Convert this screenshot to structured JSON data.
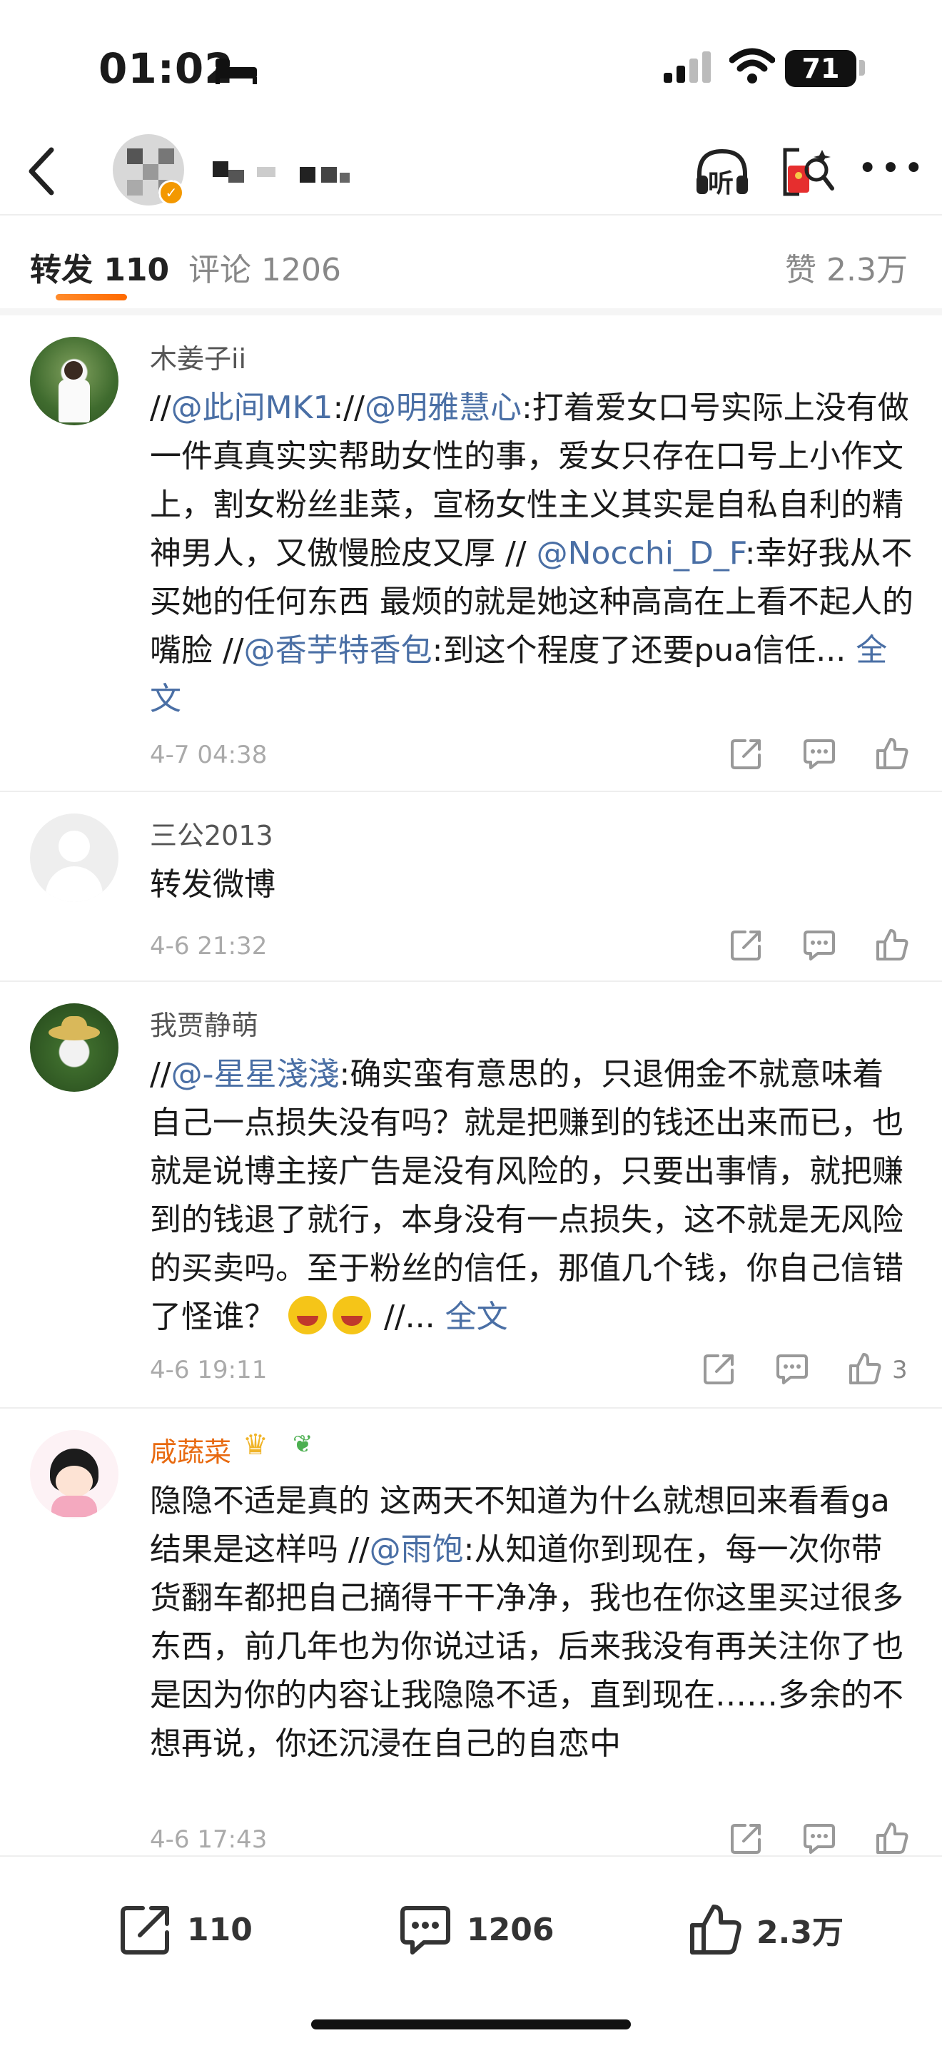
{
  "status_bar": {
    "time": "01:02",
    "battery": "71"
  },
  "nav": {
    "listen_label": "听"
  },
  "tabs": {
    "forward": "转发 110",
    "comment": "评论 1206",
    "like": "赞 2.3万"
  },
  "items": [
    {
      "username": "木姜子ii",
      "content_parts": [
        "//",
        "@此间MK1",
        ":",
        "//",
        "@明雅慧心",
        ":打着爱女口号实际上没有做一件真真实实帮助女性的事，爱女只存在口号上小作文上，割女粉丝韭菜，宣杨女性主义其实是自私自利的精神男人，又傲慢脸皮又厚 // ",
        "@Nocchi_D_F",
        ":幸好我从不买她的任何东西 最烦的就是她这种高高在上看不起人的嘴脸 //",
        "@香芋特香包",
        ":到这个程度了还要pua信任... ",
        "全文"
      ],
      "time": "4-7 04:38"
    },
    {
      "username": "三公2013",
      "content": "转发微博",
      "time": "4-6 21:32"
    },
    {
      "username": "我贾静萌",
      "content_parts": [
        "//",
        "@-星星淺淺",
        ":确实蛮有意思的，只退佣金不就意味着自己一点损失没有吗？就是把赚到的钱还出来而已，也就是说博主接广告是没有风险的，只要出事情，就把赚到的钱退了就行，本身没有一点损失，这不就是无风险的买卖吗。至于粉丝的信任，那值几个钱，你自己信错了怪谁？",
        "//... ",
        "全文"
      ],
      "time": "4-6 19:11",
      "like_count": "3"
    },
    {
      "username": "咸蔬菜",
      "content_parts": [
        "隐隐不适是真的 这两天不知道为什么就想回来看看ga 结果是这样吗 //",
        "@雨饱",
        ":从知道你到现在，每一次你带货翻车都把自己摘得干干净净，我也在你这里买过很多东西，前几年也为你说过话，后来我没有再关注你了也是因为你的内容让我隐隐不适，直到现在……多余的不想再说，你还沉浸在自己的自恋中"
      ],
      "time": "4-6 17:43"
    }
  ],
  "bottom_bar": {
    "forward": "110",
    "comment": "1206",
    "like": "2.3万"
  },
  "colors": {
    "link": "#4a6fa5",
    "accent": "#ff7a1a",
    "username_vip": "#e86a10"
  }
}
